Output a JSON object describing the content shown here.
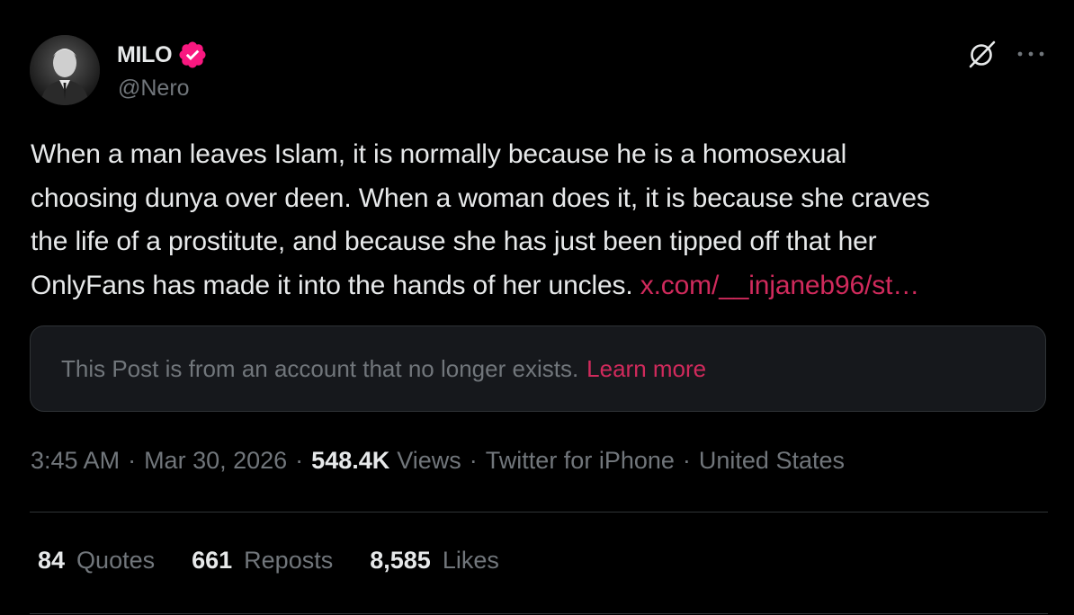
{
  "author": {
    "display_name": "MILO",
    "handle": "@Nero",
    "verified_icon": "verified-badge-icon",
    "badge_color": "#f91880"
  },
  "header_actions": {
    "grok_icon": "grok-icon",
    "more_icon": "more-horizontal-icon"
  },
  "tweet": {
    "text": "When a man leaves Islam, it is normally because he is a homosexual\nchoosing dunya over deen. When a woman does it, it is because she craves\nthe life of a prostitute, and because she has just been tipped off that her\nOnlyFans has made it into the hands of her uncles. ",
    "link_text": "x.com/__injaneb96/st…"
  },
  "quoted_notice": {
    "text": "This Post is from an account that no longer exists.",
    "learn_more": "Learn more"
  },
  "meta": {
    "time": "3:45 AM",
    "date": "Mar 30, 2026",
    "views_count": "548.4K",
    "views_label": "Views",
    "source": "Twitter for iPhone",
    "location": "United States",
    "separator": "·"
  },
  "stats": [
    {
      "count": "84",
      "label": "Quotes"
    },
    {
      "count": "661",
      "label": "Reposts"
    },
    {
      "count": "8,585",
      "label": "Likes"
    }
  ],
  "colors": {
    "background": "#000000",
    "text_primary": "#e7e9ea",
    "text_secondary": "#71767b",
    "link": "#d02a5c",
    "border": "#2f3336"
  }
}
